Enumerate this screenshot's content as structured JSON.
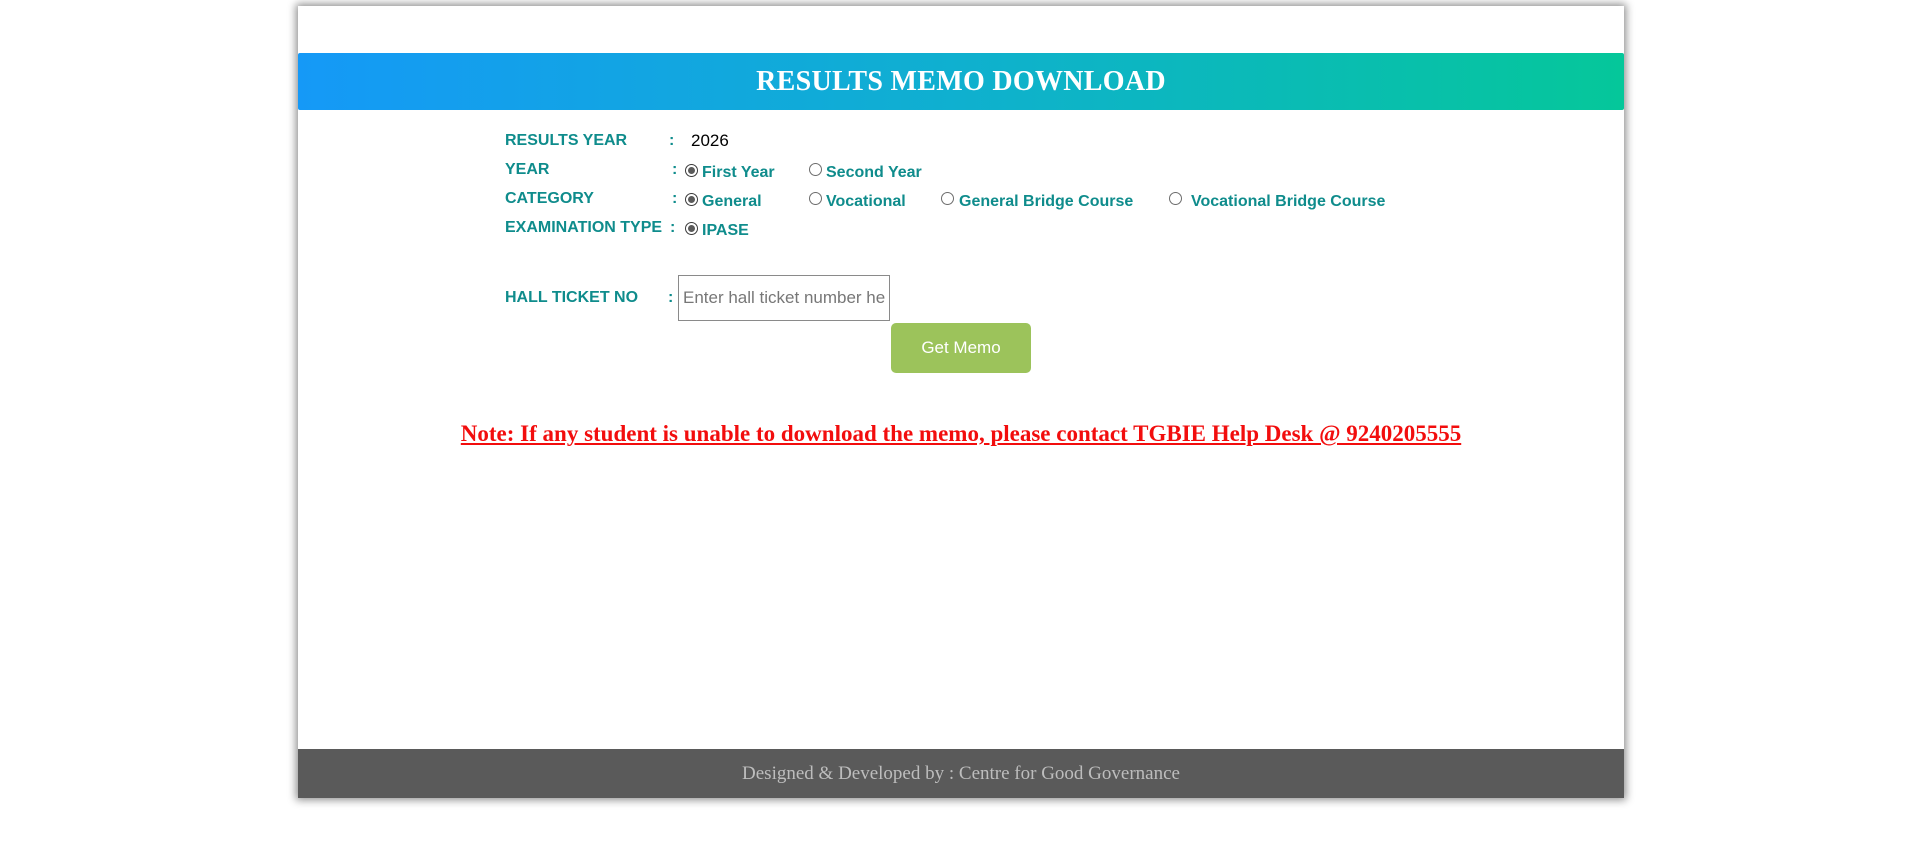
{
  "header": {
    "title": "RESULTS MEMO DOWNLOAD"
  },
  "form": {
    "colon": ":",
    "results_year": {
      "label": "RESULTS YEAR",
      "value": "2026"
    },
    "year": {
      "label": "YEAR",
      "options": [
        {
          "label": "First Year",
          "checked": true
        },
        {
          "label": "Second Year",
          "checked": false
        }
      ]
    },
    "category": {
      "label": "CATEGORY",
      "options": [
        {
          "label": "General",
          "checked": true
        },
        {
          "label": "Vocational",
          "checked": false
        },
        {
          "label": "General Bridge Course",
          "checked": false
        },
        {
          "label": "Vocational Bridge Course",
          "checked": false
        }
      ]
    },
    "exam_type": {
      "label": "EXAMINATION TYPE",
      "options": [
        {
          "label": "IPASE",
          "checked": true
        }
      ]
    },
    "hall_ticket": {
      "label": "HALL TICKET NO",
      "placeholder": "Enter hall ticket number here",
      "value": ""
    },
    "submit_label": "Get Memo"
  },
  "note": "Note: If any student is unable to download the memo, please contact TGBIE Help Desk @ 9240205555",
  "footer": {
    "text": "Designed & Developed by : Centre for Good Governance"
  },
  "colors": {
    "banner_start": "#1599f7",
    "banner_end": "#05c79a",
    "label": "#0f8c8c",
    "button": "#9cc35b",
    "note": "#f20d0d",
    "footer_bg": "#5a5a5a"
  }
}
